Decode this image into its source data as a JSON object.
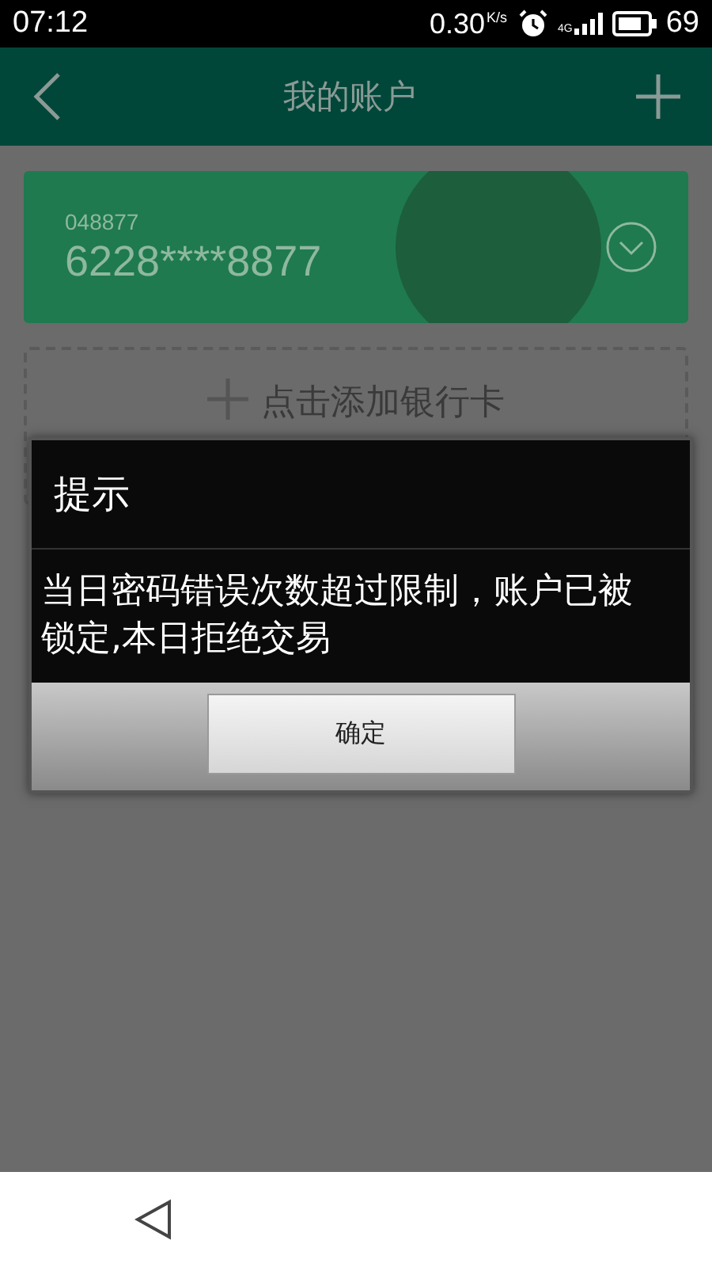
{
  "status_bar": {
    "time": "07:12",
    "speed": "0.30",
    "speed_unit": "K/s",
    "network_type": "4G",
    "battery": "69"
  },
  "header": {
    "title": "我的账户"
  },
  "cards": [
    {
      "branch": "048877",
      "number": "6228****8877"
    }
  ],
  "add_card": {
    "label": "点击添加银行卡"
  },
  "dialog": {
    "title": "提示",
    "message": "当日密码错误次数超过限制，账户已被锁定,本日拒绝交易",
    "buttons": [
      "确定"
    ]
  }
}
